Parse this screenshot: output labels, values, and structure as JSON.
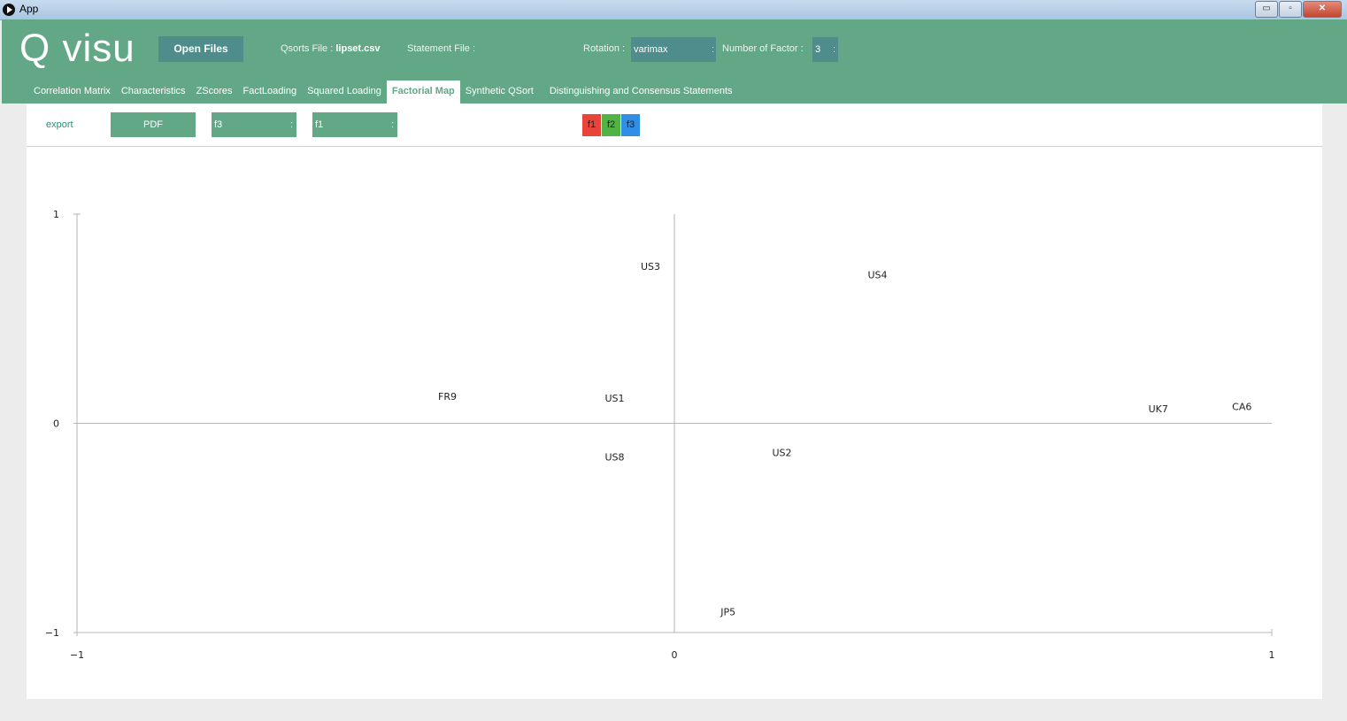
{
  "window": {
    "title": "App",
    "minimize": "▭",
    "restore": "▫",
    "close": "✕"
  },
  "header": {
    "logo": "Q visu",
    "open_files": "Open Files",
    "qsorts_label": "Qsorts File :",
    "qsorts_file": "lipset.csv",
    "statement_label": "Statement File :",
    "rotation_label": "Rotation :",
    "rotation_value": "varimax",
    "factor_label": "Number of Factor :",
    "factor_value": "3",
    "select_arrow": ":"
  },
  "tabs": [
    "Correlation Matrix",
    "Characteristics",
    "ZScores",
    "FactLoading",
    "Squared Loading",
    "Factorial Map",
    "Synthetic QSort",
    "Distinguishing and Consensus Statements"
  ],
  "active_tab": 5,
  "toolbar": {
    "export": "export",
    "pdf": "PDF",
    "x_factor": "f3",
    "y_factor": "f1",
    "arrow": ":",
    "factors": [
      {
        "label": "f1",
        "color": "#e8443a"
      },
      {
        "label": "f2",
        "color": "#4fb443"
      },
      {
        "label": "f3",
        "color": "#2f8ee5"
      }
    ]
  },
  "chart_data": {
    "type": "scatter",
    "xlim": [
      -1,
      1
    ],
    "ylim": [
      -1,
      1
    ],
    "x_ticks": [
      "−1",
      "0",
      "1"
    ],
    "y_ticks": [
      "−1",
      "0",
      "1"
    ],
    "points": [
      {
        "label": "US3",
        "x": -0.04,
        "y": 0.75
      },
      {
        "label": "US4",
        "x": 0.34,
        "y": 0.71
      },
      {
        "label": "FR9",
        "x": -0.38,
        "y": 0.13
      },
      {
        "label": "US1",
        "x": -0.1,
        "y": 0.12
      },
      {
        "label": "UK7",
        "x": 0.81,
        "y": 0.07
      },
      {
        "label": "CA6",
        "x": 0.95,
        "y": 0.08
      },
      {
        "label": "US8",
        "x": -0.1,
        "y": -0.16
      },
      {
        "label": "US2",
        "x": 0.18,
        "y": -0.14
      },
      {
        "label": "JP5",
        "x": 0.09,
        "y": -0.9
      }
    ]
  }
}
